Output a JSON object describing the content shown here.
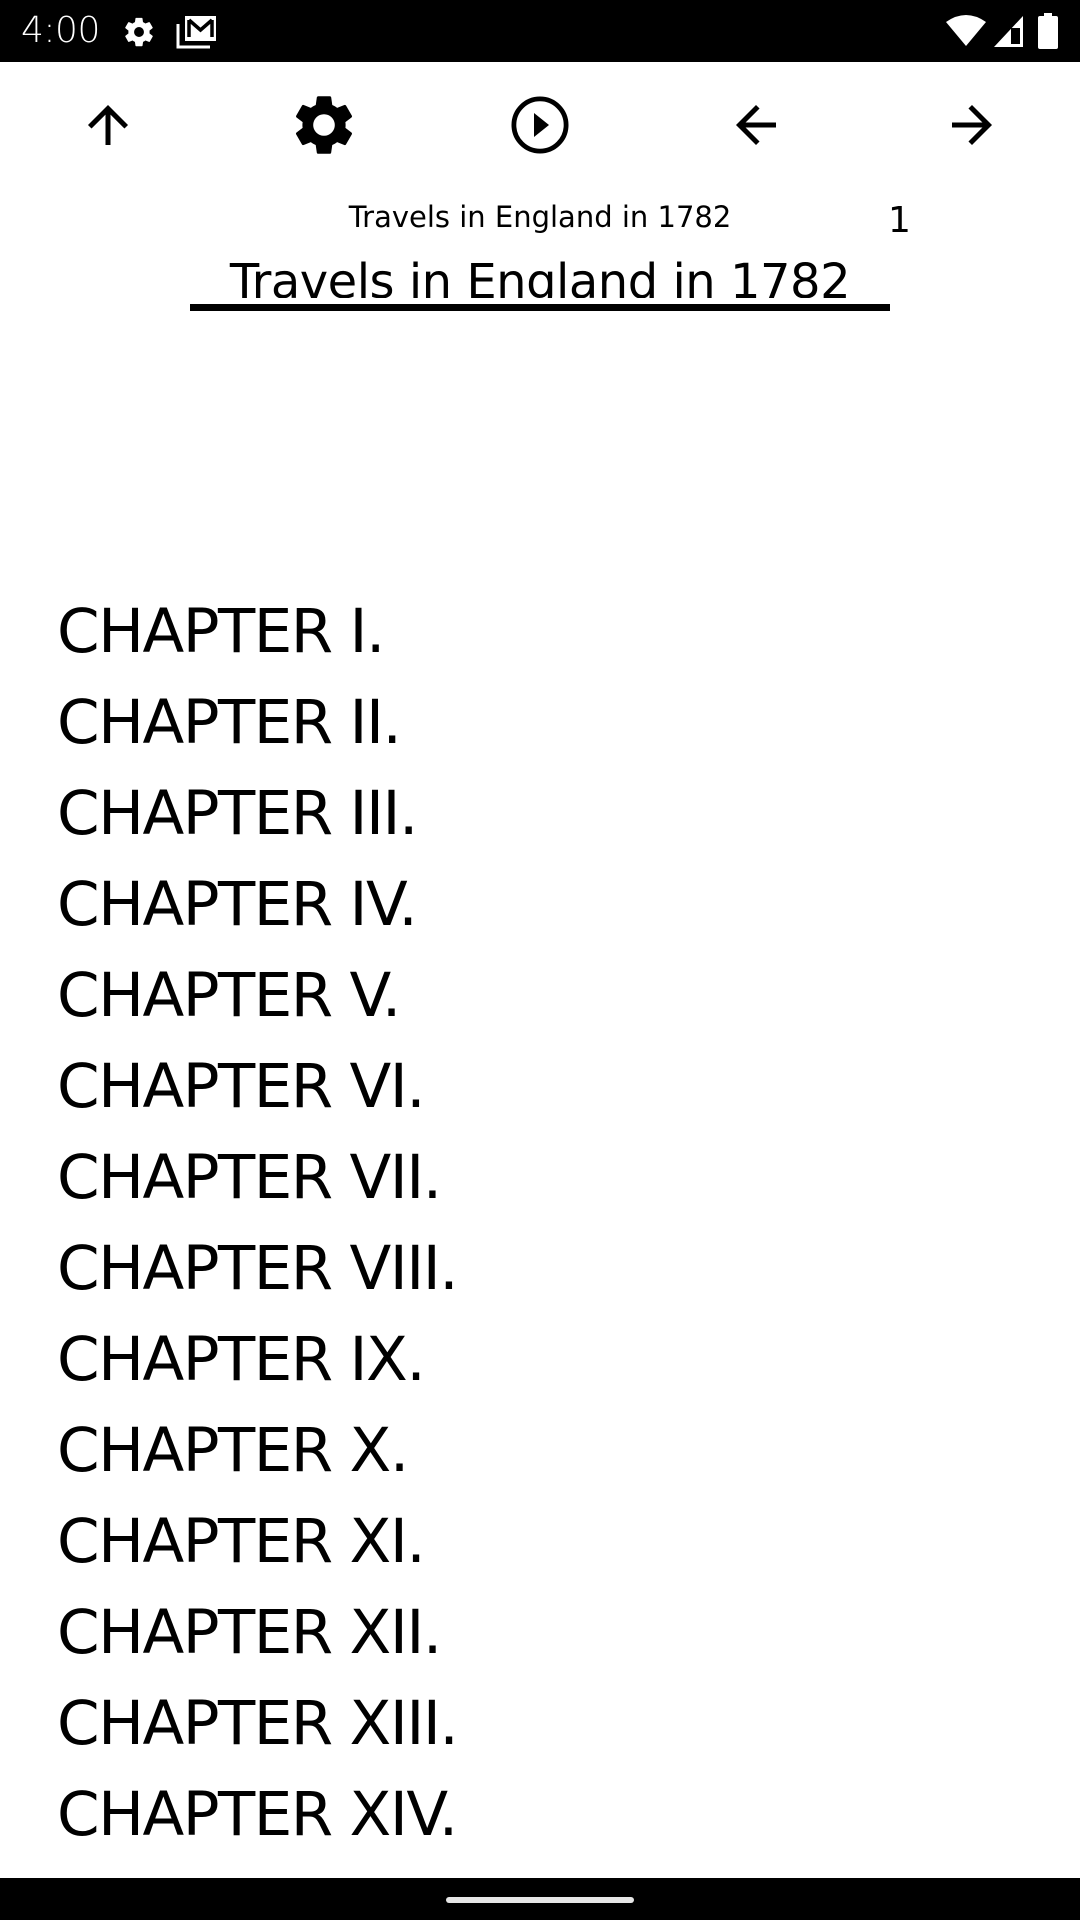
{
  "status_bar": {
    "time": "4:00",
    "left_icons": [
      "gear-icon",
      "gmail-icon"
    ],
    "right_icons": [
      "wifi-icon",
      "cell-signal-icon",
      "battery-icon"
    ]
  },
  "toolbar": {
    "buttons": [
      {
        "name": "up-button",
        "icon": "arrow-up-icon"
      },
      {
        "name": "settings-button",
        "icon": "gear-icon"
      },
      {
        "name": "play-button",
        "icon": "play-circle-icon"
      },
      {
        "name": "previous-button",
        "icon": "arrow-left-icon"
      },
      {
        "name": "next-button",
        "icon": "arrow-right-icon"
      }
    ]
  },
  "header": {
    "book_title_small": "Travels in England in 1782",
    "page_number": "1"
  },
  "document": {
    "title": "Travels in England in 1782",
    "chapters": [
      "CHAPTER I.",
      "CHAPTER II.",
      "CHAPTER III.",
      "CHAPTER IV.",
      "CHAPTER V.",
      "CHAPTER VI.",
      "CHAPTER VII.",
      "CHAPTER VIII.",
      "CHAPTER IX.",
      "CHAPTER X.",
      "CHAPTER XI.",
      "CHAPTER XII.",
      "CHAPTER XIII.",
      "CHAPTER XIV."
    ]
  }
}
